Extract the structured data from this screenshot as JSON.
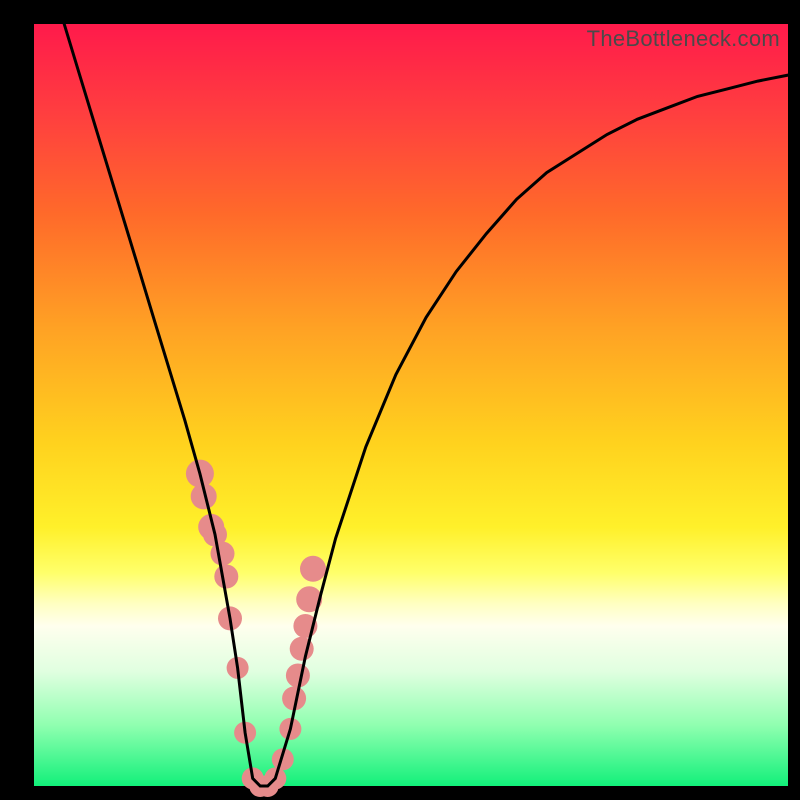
{
  "watermark": "TheBottleneck.com",
  "colors": {
    "frame": "#000000",
    "gradient_top": "#ff1a4b",
    "gradient_mid": "#ffff6a",
    "gradient_bottom": "#12f07a",
    "curve": "#000000",
    "marker": "#e68b8b"
  },
  "chart_data": {
    "type": "line",
    "title": "",
    "xlabel": "",
    "ylabel": "",
    "xlim": [
      0,
      100
    ],
    "ylim": [
      0,
      1
    ],
    "series": [
      {
        "name": "bottleneck-curve",
        "x": [
          4,
          6,
          8,
          10,
          12,
          14,
          16,
          18,
          20,
          22,
          24,
          26,
          27,
          28,
          29,
          30,
          31,
          32,
          34,
          36,
          38,
          40,
          44,
          48,
          52,
          56,
          60,
          64,
          68,
          72,
          76,
          80,
          84,
          88,
          92,
          96,
          100
        ],
        "y": [
          1.0,
          0.935,
          0.87,
          0.805,
          0.74,
          0.675,
          0.61,
          0.545,
          0.48,
          0.41,
          0.33,
          0.22,
          0.155,
          0.07,
          0.01,
          0.0,
          0.0,
          0.01,
          0.075,
          0.17,
          0.25,
          0.325,
          0.445,
          0.54,
          0.615,
          0.675,
          0.725,
          0.77,
          0.805,
          0.83,
          0.855,
          0.875,
          0.89,
          0.905,
          0.915,
          0.925,
          0.933
        ]
      }
    ],
    "markers": {
      "name": "highlighted-points",
      "x": [
        22.0,
        22.5,
        23.5,
        24.0,
        25.0,
        25.5,
        26.0,
        27.0,
        28.0,
        29.0,
        30.0,
        31.0,
        32.0,
        33.0,
        34.0,
        34.5,
        35.0,
        35.5,
        36.0,
        36.5,
        37.0
      ],
      "y": [
        0.41,
        0.38,
        0.34,
        0.33,
        0.305,
        0.275,
        0.22,
        0.155,
        0.07,
        0.01,
        0.0,
        0.0,
        0.01,
        0.035,
        0.075,
        0.115,
        0.145,
        0.18,
        0.21,
        0.245,
        0.285
      ],
      "r": [
        14,
        13,
        13,
        12,
        12,
        12,
        12,
        11,
        11,
        11,
        11,
        11,
        11,
        11,
        11,
        12,
        12,
        12,
        12,
        13,
        13
      ]
    }
  }
}
